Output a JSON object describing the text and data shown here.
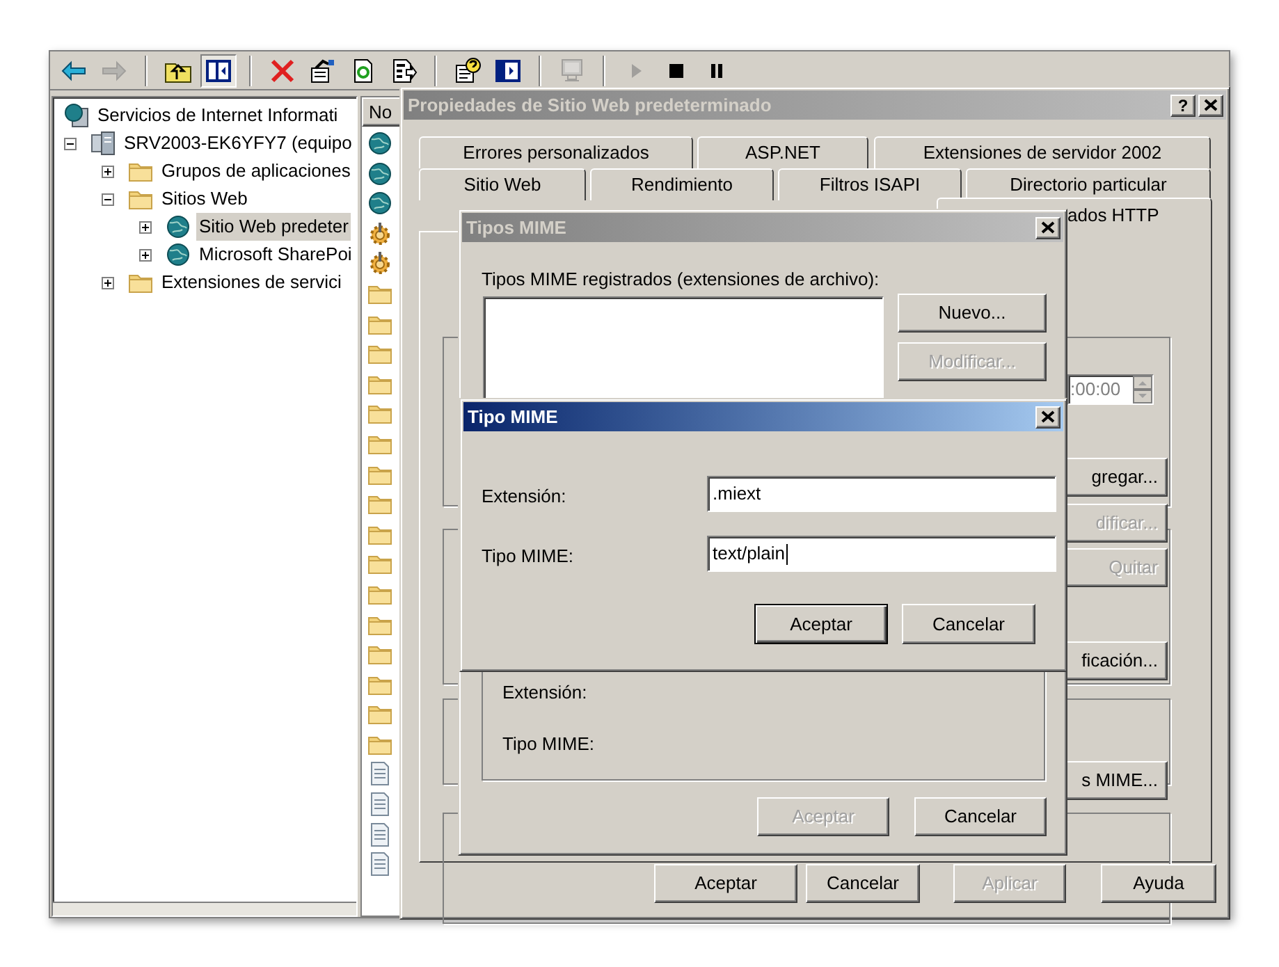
{
  "toolbar": [
    {
      "kind": "back",
      "disabled": false,
      "pressed": false
    },
    {
      "kind": "forward",
      "disabled": true,
      "pressed": false
    },
    {
      "kind": "separator"
    },
    {
      "kind": "up",
      "disabled": false,
      "pressed": false
    },
    {
      "kind": "tree",
      "disabled": false,
      "pressed": true
    },
    {
      "kind": "separator"
    },
    {
      "kind": "delete",
      "disabled": false,
      "pressed": false
    },
    {
      "kind": "properties",
      "disabled": false,
      "pressed": false
    },
    {
      "kind": "refresh",
      "disabled": false,
      "pressed": false
    },
    {
      "kind": "export",
      "disabled": false,
      "pressed": false
    },
    {
      "kind": "separator"
    },
    {
      "kind": "help",
      "disabled": false,
      "pressed": false
    },
    {
      "kind": "console",
      "disabled": false,
      "pressed": false
    },
    {
      "kind": "separator"
    },
    {
      "kind": "computer",
      "disabled": true,
      "pressed": false
    },
    {
      "kind": "separator"
    },
    {
      "kind": "play",
      "disabled": true,
      "pressed": false
    },
    {
      "kind": "stop",
      "disabled": false,
      "pressed": false
    },
    {
      "kind": "pause",
      "disabled": false,
      "pressed": false
    }
  ],
  "tree": {
    "label": "Servicios de Internet Informati",
    "children": [
      {
        "label": "SRV2003-EK6YFY7 (equipo",
        "kind": "server",
        "expanded": true,
        "selected": false,
        "children": [
          {
            "label": "Grupos de aplicaciones",
            "kind": "folder",
            "expanded": false,
            "selected": false
          },
          {
            "label": "Sitios Web",
            "kind": "folder",
            "expanded": true,
            "selected": false,
            "children": [
              {
                "label": "Sitio Web predeter",
                "kind": "site",
                "expanded": false,
                "selected": true
              },
              {
                "label": "Microsoft SharePoi",
                "kind": "site",
                "expanded": false,
                "selected": false
              }
            ]
          },
          {
            "label": "Extensiones de servici",
            "kind": "folder",
            "expanded": false,
            "selected": false
          }
        ]
      }
    ]
  },
  "list_pane": {
    "header": "No",
    "items": [
      {
        "kind": "site"
      },
      {
        "kind": "site"
      },
      {
        "kind": "site"
      },
      {
        "kind": "gear"
      },
      {
        "kind": "gear"
      },
      {
        "kind": "folder"
      },
      {
        "kind": "folder"
      },
      {
        "kind": "folder"
      },
      {
        "kind": "folder"
      },
      {
        "kind": "folder"
      },
      {
        "kind": "folder"
      },
      {
        "kind": "folder"
      },
      {
        "kind": "folder"
      },
      {
        "kind": "folder"
      },
      {
        "kind": "folder"
      },
      {
        "kind": "folder"
      },
      {
        "kind": "folder"
      },
      {
        "kind": "folder"
      },
      {
        "kind": "folder"
      },
      {
        "kind": "folder"
      },
      {
        "kind": "folder"
      },
      {
        "kind": "document"
      },
      {
        "kind": "document"
      },
      {
        "kind": "document"
      },
      {
        "kind": "document"
      }
    ]
  },
  "properties_dialog": {
    "title": "Propiedades de Sitio Web predeterminado",
    "active": false,
    "help_button": "?",
    "tab_rows": [
      [
        {
          "label": "Errores personalizados",
          "selected": false
        },
        {
          "label": "ASP.NET",
          "selected": false
        },
        {
          "label": "Extensiones de servidor 2002",
          "selected": false
        }
      ],
      [
        {
          "label": "Sitio Web",
          "selected": false
        },
        {
          "label": "Rendimiento",
          "selected": false
        },
        {
          "label": "Filtros ISAPI",
          "selected": false
        },
        {
          "label": "Directorio particular",
          "selected": false
        }
      ],
      [
        {
          "label": "ados HTTP",
          "selected": true
        }
      ]
    ],
    "partial_controls": [
      {
        "kind": "spin",
        "text": ":00:00",
        "disabled": true
      },
      {
        "kind": "button",
        "text": "gregar...",
        "disabled": false
      },
      {
        "kind": "button",
        "text": "dificar...",
        "disabled": true
      },
      {
        "kind": "button",
        "text": "Quitar",
        "disabled": true
      },
      {
        "kind": "button",
        "text": "ficación...",
        "disabled": false
      },
      {
        "kind": "button",
        "text": "s MIME...",
        "disabled": false
      }
    ],
    "buttons": [
      {
        "label": "Aceptar",
        "disabled": false
      },
      {
        "label": "Cancelar",
        "disabled": false
      },
      {
        "label": "Aplicar",
        "disabled": true
      },
      {
        "label": "Ayuda",
        "disabled": false
      }
    ]
  },
  "mime_types_dialog": {
    "title": "Tipos MIME",
    "active": false,
    "list_label": "Tipos MIME registrados (extensiones de archivo):",
    "side_buttons": [
      {
        "label": "Nuevo...",
        "disabled": false
      },
      {
        "label": "Modificar...",
        "disabled": true
      }
    ],
    "details": [
      "Extensión:",
      "Tipo MIME:"
    ],
    "buttons": [
      {
        "label": "Aceptar",
        "disabled": true
      },
      {
        "label": "Cancelar",
        "disabled": false
      }
    ]
  },
  "mime_type_dialog": {
    "title": "Tipo MIME",
    "active": true,
    "fields": [
      {
        "label": "Extensión:",
        "value": ".miext",
        "focused": false
      },
      {
        "label": "Tipo MIME:",
        "value": "text/plain",
        "focused": true
      }
    ],
    "buttons": [
      {
        "label": "Aceptar",
        "default": true
      },
      {
        "label": "Cancelar",
        "default": false
      }
    ]
  }
}
